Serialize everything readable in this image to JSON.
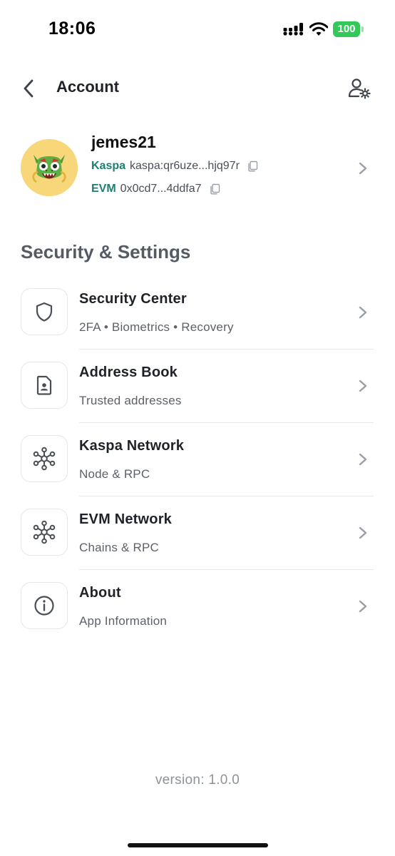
{
  "status_bar": {
    "time": "18:06",
    "battery": "100",
    "icons": [
      "signal-icon",
      "wifi-icon",
      "battery-icon"
    ]
  },
  "nav": {
    "title": "Account",
    "left_icon": "chevron-left-icon",
    "right_icon": "account-settings-icon"
  },
  "profile": {
    "username": "jemes21",
    "avatar_icon": "dragon-avatar-icon",
    "kaspa": {
      "label": "Kaspa",
      "address": "kaspa:qr6uze...hjq97r"
    },
    "evm": {
      "label": "EVM",
      "address": "0x0cd7...4ddfa7"
    }
  },
  "section": {
    "title": "Security & Settings"
  },
  "menu": {
    "items": [
      {
        "title": "Security Center",
        "subtitle": "2FA • Biometrics • Recovery",
        "icon": "shield-icon"
      },
      {
        "title": "Address Book",
        "subtitle": "Trusted addresses",
        "icon": "contact-file-icon"
      },
      {
        "title": "Kaspa Network",
        "subtitle": "Node & RPC",
        "icon": "network-icon"
      },
      {
        "title": "EVM Network",
        "subtitle": "Chains & RPC",
        "icon": "network-icon"
      },
      {
        "title": "About",
        "subtitle": "App Information",
        "icon": "info-icon"
      }
    ]
  },
  "footer": {
    "version": "version: 1.0.0"
  },
  "colors": {
    "accent": "#1d7f6f",
    "avatar_bg": "#f7d77a",
    "battery": "#34c759",
    "text_primary": "#1f2229",
    "text_secondary": "#5c616a"
  }
}
